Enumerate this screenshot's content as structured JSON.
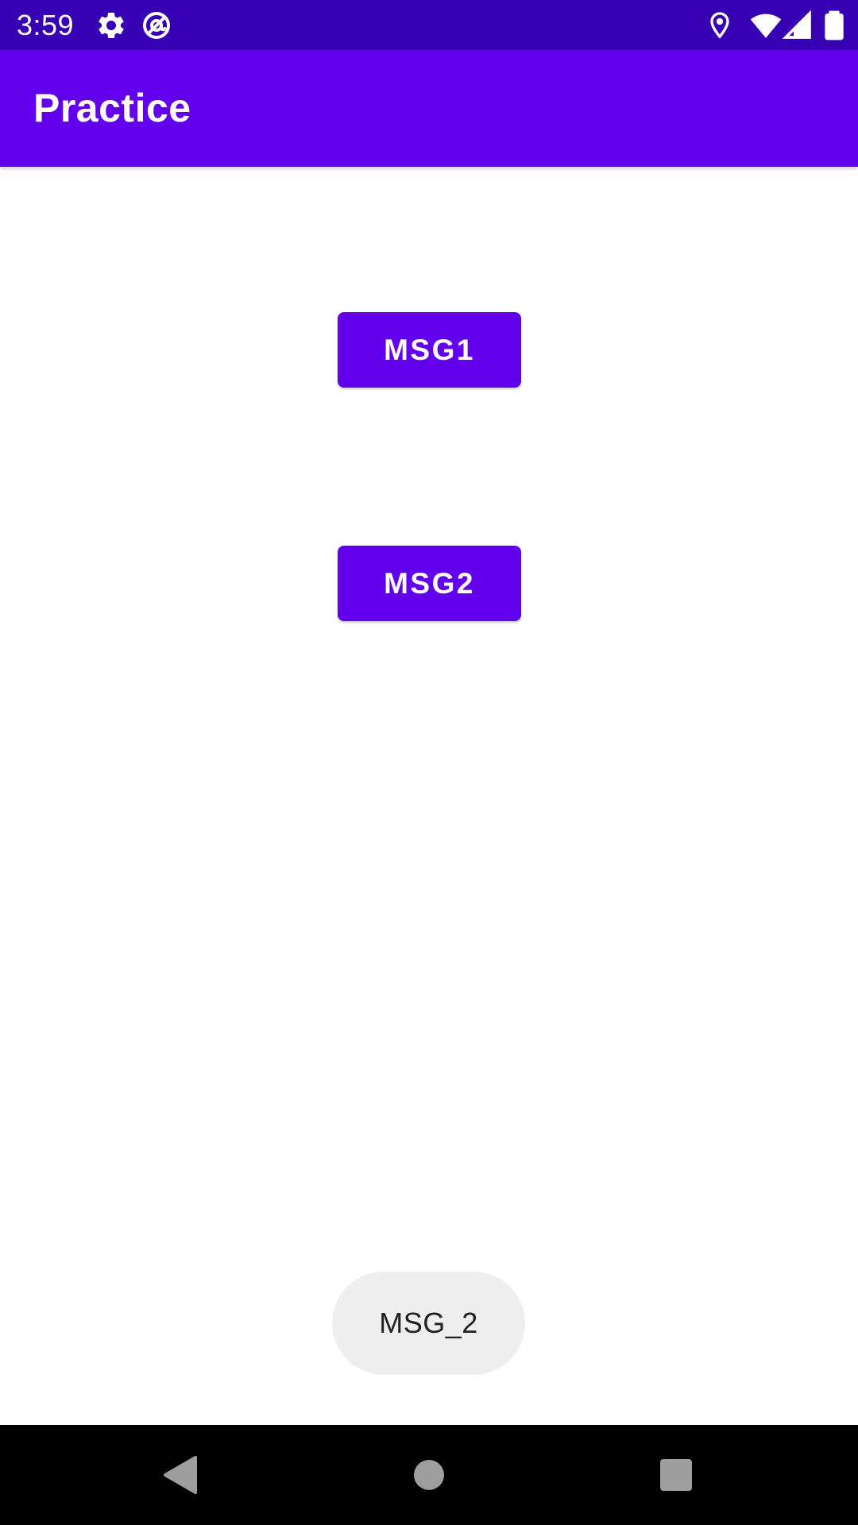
{
  "status_bar": {
    "time": "3:59",
    "icons_left": [
      "gear-icon",
      "at-sign-icon"
    ],
    "icons_right": [
      "location-pin-icon",
      "wifi-icon",
      "cell-signal-icon",
      "battery-icon"
    ],
    "background_color": "#3700B3"
  },
  "app_bar": {
    "title": "Practice",
    "background_color": "#6200EE"
  },
  "buttons": [
    {
      "label": "MSG1"
    },
    {
      "label": "MSG2"
    }
  ],
  "toast": {
    "text": "MSG_2"
  },
  "nav_bar": {
    "buttons": [
      "back-icon",
      "home-icon",
      "recents-icon"
    ]
  }
}
